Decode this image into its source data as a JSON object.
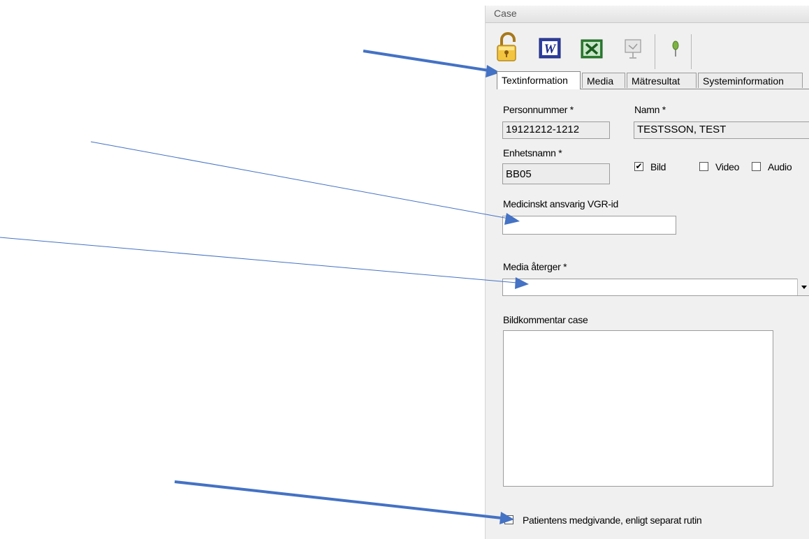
{
  "window": {
    "title": "Case"
  },
  "toolbar": {
    "buttons": [
      {
        "icon": "unlock-icon"
      },
      {
        "icon": "word-icon"
      },
      {
        "icon": "excel-icon"
      },
      {
        "icon": "presentation-icon"
      },
      {
        "icon": "pin-icon"
      }
    ]
  },
  "tabs": [
    "Textinformation",
    "Media",
    "Mätresultat",
    "Systeminformation"
  ],
  "form": {
    "personnummer_label": "Personnummer *",
    "personnummer_value": "19121212-1212",
    "namn_label": "Namn *",
    "namn_value": "TESTSSON, TEST",
    "enhetsnamn_label": "Enhetsnamn *",
    "enhetsnamn_value": "BB05",
    "bild_label": "Bild",
    "bild_checked": true,
    "video_label": "Video",
    "video_checked": false,
    "audio_label": "Audio",
    "audio_checked": false,
    "medicinskt_label": "Medicinskt ansvarig VGR-id",
    "medicinskt_value": "",
    "media_label": "Media återger *",
    "media_value": "",
    "bildkommentar_label": "Bildkommentar case",
    "bildkommentar_value": "",
    "patient_label": "Patientens medgivande, enligt separat rutin",
    "patient_checked": false
  },
  "colors": {
    "annotation_arrow": "#4472c4",
    "panel_bg": "#f0f0f0"
  }
}
